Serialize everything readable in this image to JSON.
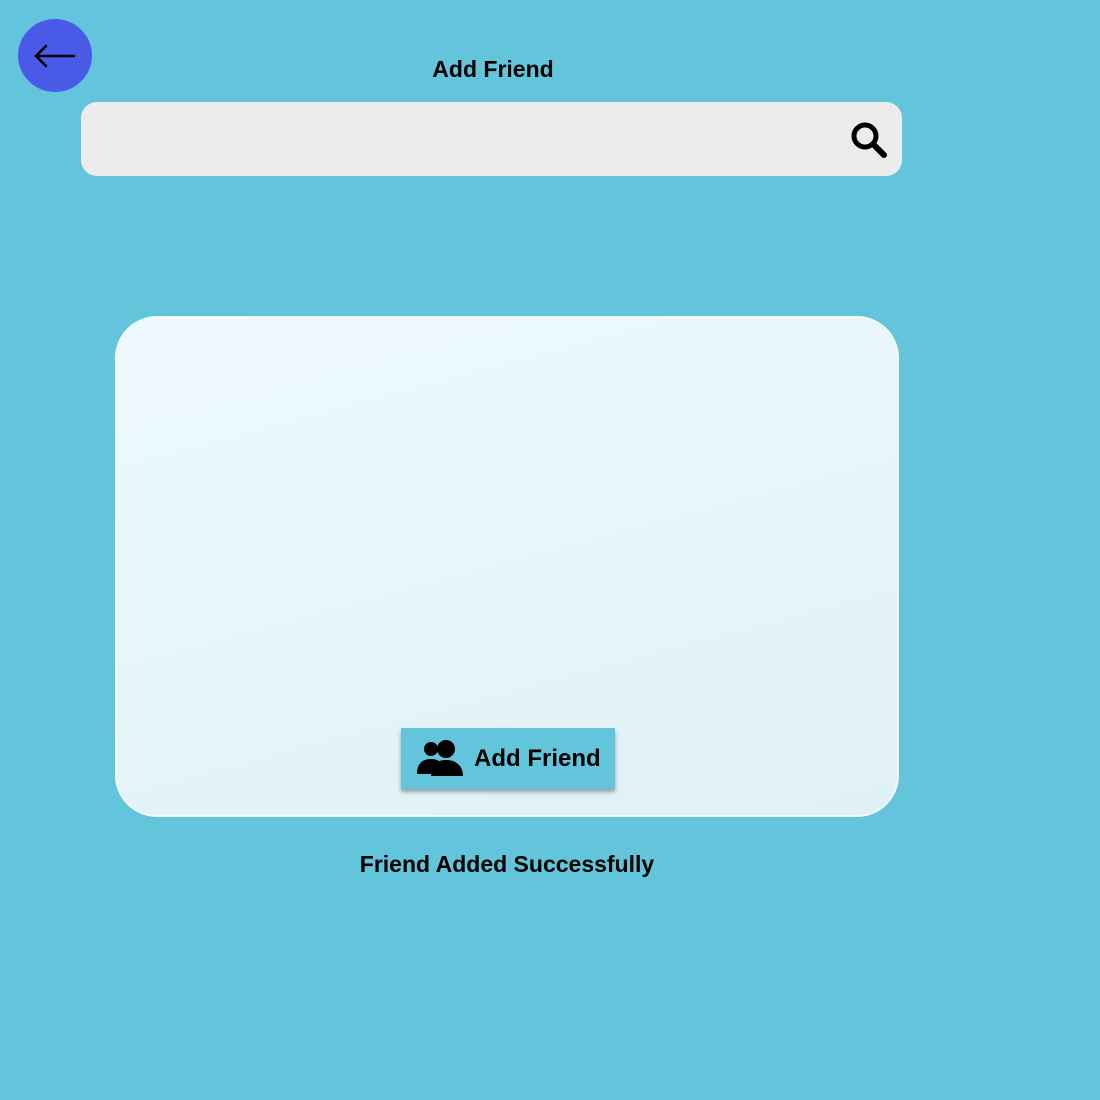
{
  "header": {
    "title": "Add Friend",
    "back_icon": "arrow-left-icon"
  },
  "search": {
    "value": "",
    "placeholder": "",
    "icon": "search-icon"
  },
  "card": {
    "button_label": "Add Friend",
    "button_icon": "user-group-icon"
  },
  "status": {
    "message": "Friend Added Successfully"
  },
  "colors": {
    "background": "#62c5dc",
    "back_button": "#4a5ae8",
    "search_bar": "#ececec",
    "card": "#e6f6fa",
    "button": "#62c5dc"
  }
}
